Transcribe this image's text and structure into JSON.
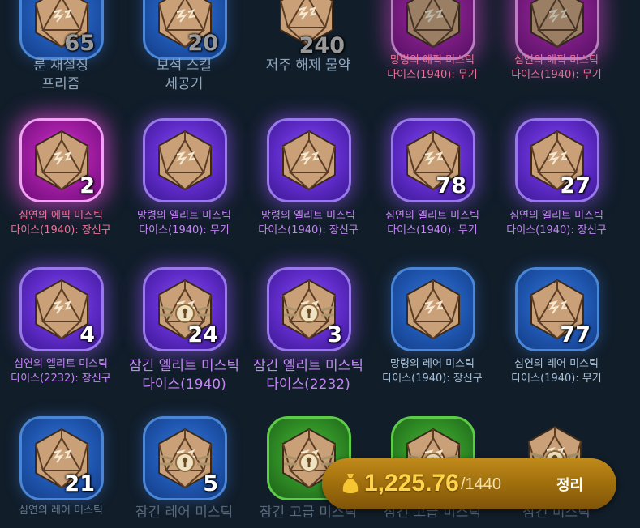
{
  "colors": {
    "background": "#111d29",
    "epic": "#a51fa6",
    "elite": "#5f2bc8",
    "rare": "#1f56b0",
    "advanced": "#2e8a24",
    "wallet_amount": "#ffd34a"
  },
  "inventory": {
    "rows": [
      {
        "items": [
          {
            "icon": "rune-reset-prism-icon",
            "rarity": "rare",
            "quantity": "65",
            "label_lines": [
              "룬 재설정",
              "프리즘"
            ],
            "label_color": "grey"
          },
          {
            "icon": "gem-skill-cutter-icon",
            "rarity": "rare",
            "quantity": "20",
            "label_lines": [
              "보석 스킬",
              "세공기"
            ],
            "label_color": "grey"
          },
          {
            "icon": "curse-removal-potion-icon",
            "rarity": "none",
            "quantity": "240",
            "label_lines": [
              "저주 해제 물약"
            ],
            "label_color": "grey"
          },
          {
            "icon": "mystic-dice-icon",
            "rarity": "epic",
            "quantity": "",
            "label_lines": [
              "망령의 에픽 미스틱",
              "다이스(1940): 무기"
            ],
            "label_color": "pink"
          },
          {
            "icon": "mystic-dice-icon",
            "rarity": "epic",
            "quantity": "",
            "label_lines": [
              "심연의 에픽 미스틱",
              "다이스(1940): 무기"
            ],
            "label_color": "pink"
          }
        ]
      },
      {
        "items": [
          {
            "icon": "mystic-dice-icon",
            "rarity": "epic",
            "quantity": "2",
            "label_lines": [
              "심연의 에픽 미스틱",
              "다이스(1940): 장신구"
            ],
            "label_color": "pink"
          },
          {
            "icon": "mystic-dice-icon",
            "rarity": "elite",
            "quantity": "",
            "label_lines": [
              "망령의 엘리트 미스틱",
              "다이스(1940): 무기"
            ],
            "label_color": "purple"
          },
          {
            "icon": "mystic-dice-icon",
            "rarity": "elite",
            "quantity": "",
            "label_lines": [
              "망령의 엘리트 미스틱",
              "다이스(1940): 장신구"
            ],
            "label_color": "purple"
          },
          {
            "icon": "mystic-dice-icon",
            "rarity": "elite",
            "quantity": "78",
            "label_lines": [
              "심연의 엘리트 미스틱",
              "다이스(1940): 무기"
            ],
            "label_color": "purple"
          },
          {
            "icon": "mystic-dice-icon",
            "rarity": "elite",
            "quantity": "27",
            "label_lines": [
              "심연의 엘리트 미스틱",
              "다이스(1940): 장신구"
            ],
            "label_color": "purple"
          }
        ]
      },
      {
        "items": [
          {
            "icon": "mystic-dice-icon",
            "rarity": "elite",
            "quantity": "4",
            "label_lines": [
              "심연의 엘리트 미스틱",
              "다이스(2232): 장신구"
            ],
            "label_color": "purple"
          },
          {
            "icon": "locked-mystic-dice-icon",
            "rarity": "elite",
            "quantity": "24",
            "label_lines": [
              "잠긴 엘리트 미스틱",
              "다이스(1940)"
            ],
            "label_color": "purple"
          },
          {
            "icon": "locked-mystic-dice-icon",
            "rarity": "elite",
            "quantity": "3",
            "label_lines": [
              "잠긴 엘리트 미스틱",
              "다이스(2232)"
            ],
            "label_color": "purple"
          },
          {
            "icon": "mystic-dice-icon",
            "rarity": "rare",
            "quantity": "",
            "label_lines": [
              "망령의 레어 미스틱",
              "다이스(1940): 장신구"
            ],
            "label_color": "blue"
          },
          {
            "icon": "mystic-dice-icon",
            "rarity": "rare",
            "quantity": "77",
            "label_lines": [
              "심연의 레어 미스틱",
              "다이스(1940): 무기"
            ],
            "label_color": "blue"
          }
        ]
      },
      {
        "items": [
          {
            "icon": "mystic-dice-icon",
            "rarity": "rare",
            "quantity": "21",
            "label_lines": [
              "심연의 레어 미스틱"
            ],
            "label_color": "blue"
          },
          {
            "icon": "locked-mystic-dice-icon",
            "rarity": "rare",
            "quantity": "5",
            "label_lines": [
              "잠긴 레어 미스틱"
            ],
            "label_color": "grey"
          },
          {
            "icon": "locked-mystic-dice-icon",
            "rarity": "advanced",
            "quantity": "",
            "label_lines": [
              "잠긴 고급 미스틱"
            ],
            "label_color": "grey"
          },
          {
            "icon": "locked-mystic-dice-icon",
            "rarity": "advanced",
            "quantity": "",
            "label_lines": [
              "잠긴 고급 미스틱"
            ],
            "label_color": "grey"
          },
          {
            "icon": "locked-mystic-dice-icon",
            "rarity": "none",
            "quantity": "",
            "label_lines": [
              "잠긴 미스틱"
            ],
            "label_color": "grey"
          }
        ]
      }
    ]
  },
  "wallet": {
    "icon": "money-bag-icon",
    "amount": "1,225.76",
    "capacity": "/1440"
  },
  "sort_button": {
    "label": "정리"
  }
}
